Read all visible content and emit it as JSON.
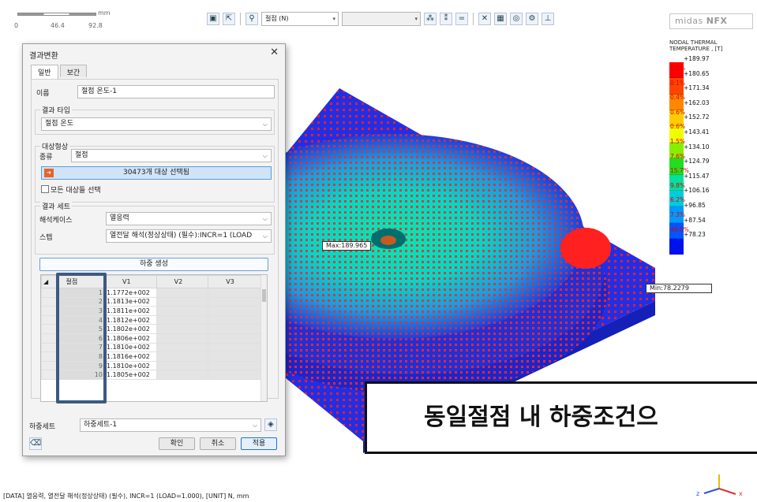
{
  "ruler": {
    "unit": "mm",
    "ticks": [
      "0",
      "46.4",
      "92.8"
    ]
  },
  "toolbar": {
    "select1": "절점 (N)",
    "select2": ""
  },
  "brand": {
    "name": "midas",
    "product": "NFX"
  },
  "legend": {
    "title_line1": "NODAL THERMAL",
    "title_line2": "TEMPERATURE , [T]",
    "values": [
      "+189.97",
      "+180.65",
      "+171.34",
      "+162.03",
      "+152.72",
      "+143.41",
      "+134.10",
      "+124.79",
      "+115.47",
      "+106.16",
      "+96.85",
      "+87.54",
      "+78.23"
    ],
    "percents": [
      "0.5%",
      "0.1%",
      "0.4%",
      "0.6%",
      "0.6%",
      "1.5%",
      "7.6%",
      "15.7%",
      "9.8%",
      "6.2%",
      "7.3%",
      "49.6%"
    ],
    "colors": [
      "#ff0000",
      "#ff4400",
      "#ff8800",
      "#ffcc00",
      "#eeff00",
      "#88ee00",
      "#22dd22",
      "#00e0a0",
      "#00ccdd",
      "#0099ff",
      "#0055ff",
      "#0011ee"
    ]
  },
  "viewport": {
    "max_label": "Max:189.965",
    "min_label": "Min:78.2279"
  },
  "banner": {
    "text": "동일절점 내 하중조건으"
  },
  "status": {
    "text": "[DATA] 열응력, 열전달 해석(정상상태) (필수), INCR=1 (LOAD=1.000), [UNIT] N, mm"
  },
  "dialog": {
    "title": "결과변환",
    "tabs": [
      "일반",
      "보간"
    ],
    "name_label": "이름",
    "name_value": "절점 온도-1",
    "result_type_group": "결과 타입",
    "result_type_value": "절점 온도",
    "target_group": "대상형상",
    "kind_label": "종류",
    "kind_value": "절점",
    "select_button": "30473개 대상 선택됨",
    "all_targets_label": "모든 대상들 선택",
    "result_set_group": "결과 세트",
    "analysis_case_label": "해석케이스",
    "analysis_case_value": "열응력",
    "step_label": "스텝",
    "step_value": "열전달 해석(정상상태) (필수):INCR=1 (LOAD",
    "generate_button": "하중 생성",
    "table": {
      "headers": [
        "절점",
        "V1",
        "V2",
        "V3"
      ],
      "rows": [
        {
          "node": "1",
          "v1": "1.1772e+002"
        },
        {
          "node": "2",
          "v1": "1.1813e+002"
        },
        {
          "node": "3",
          "v1": "1.1811e+002"
        },
        {
          "node": "4",
          "v1": "1.1812e+002"
        },
        {
          "node": "5",
          "v1": "1.1802e+002"
        },
        {
          "node": "6",
          "v1": "1.1806e+002"
        },
        {
          "node": "7",
          "v1": "1.1810e+002"
        },
        {
          "node": "8",
          "v1": "1.1816e+002"
        },
        {
          "node": "9",
          "v1": "1.1810e+002"
        },
        {
          "node": "10",
          "v1": "1.1805e+002"
        }
      ]
    },
    "loadset_label": "하중세트",
    "loadset_value": "하중세트-1",
    "ok_button": "확인",
    "cancel_button": "취소",
    "apply_button": "적용"
  }
}
